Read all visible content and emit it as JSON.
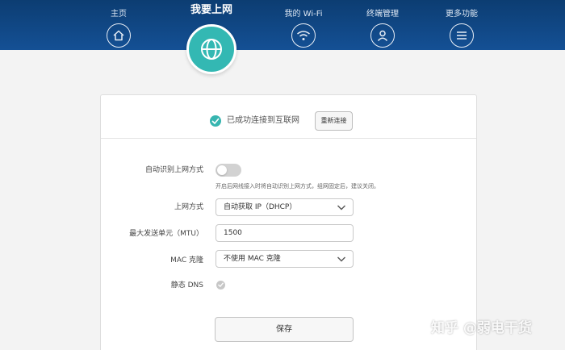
{
  "nav": {
    "items": [
      {
        "label": "主页",
        "icon": "home-icon"
      },
      {
        "label": "我要上网",
        "icon": "globe-icon",
        "active": true
      },
      {
        "label": "我的 Wi-Fi",
        "icon": "wifi-icon"
      },
      {
        "label": "终端管理",
        "icon": "user-icon"
      },
      {
        "label": "更多功能",
        "icon": "menu-icon"
      }
    ]
  },
  "colors": {
    "nav_bg": "#0c3d72",
    "accent": "#33b8b3",
    "card_bg": "#ffffff",
    "page_bg": "#f3f3f3"
  },
  "status": {
    "text": "已成功连接到互联网",
    "reconnect_label": "重新连接"
  },
  "form": {
    "auto_detect": {
      "label": "自动识别上网方式",
      "enabled": false,
      "hint": "开启后网线接入时将自动识别上网方式，组网固定后，建议关闭。"
    },
    "connection_type": {
      "label": "上网方式",
      "value": "自动获取 IP（DHCP）"
    },
    "mtu": {
      "label": "最大发送单元（MTU）",
      "value": "1500"
    },
    "mac_clone": {
      "label": "MAC 克隆",
      "value": "不使用 MAC 克隆"
    },
    "static_dns": {
      "label": "静态 DNS",
      "checked": false
    },
    "save_label": "保存"
  },
  "watermark": "知乎 @弱电干货"
}
